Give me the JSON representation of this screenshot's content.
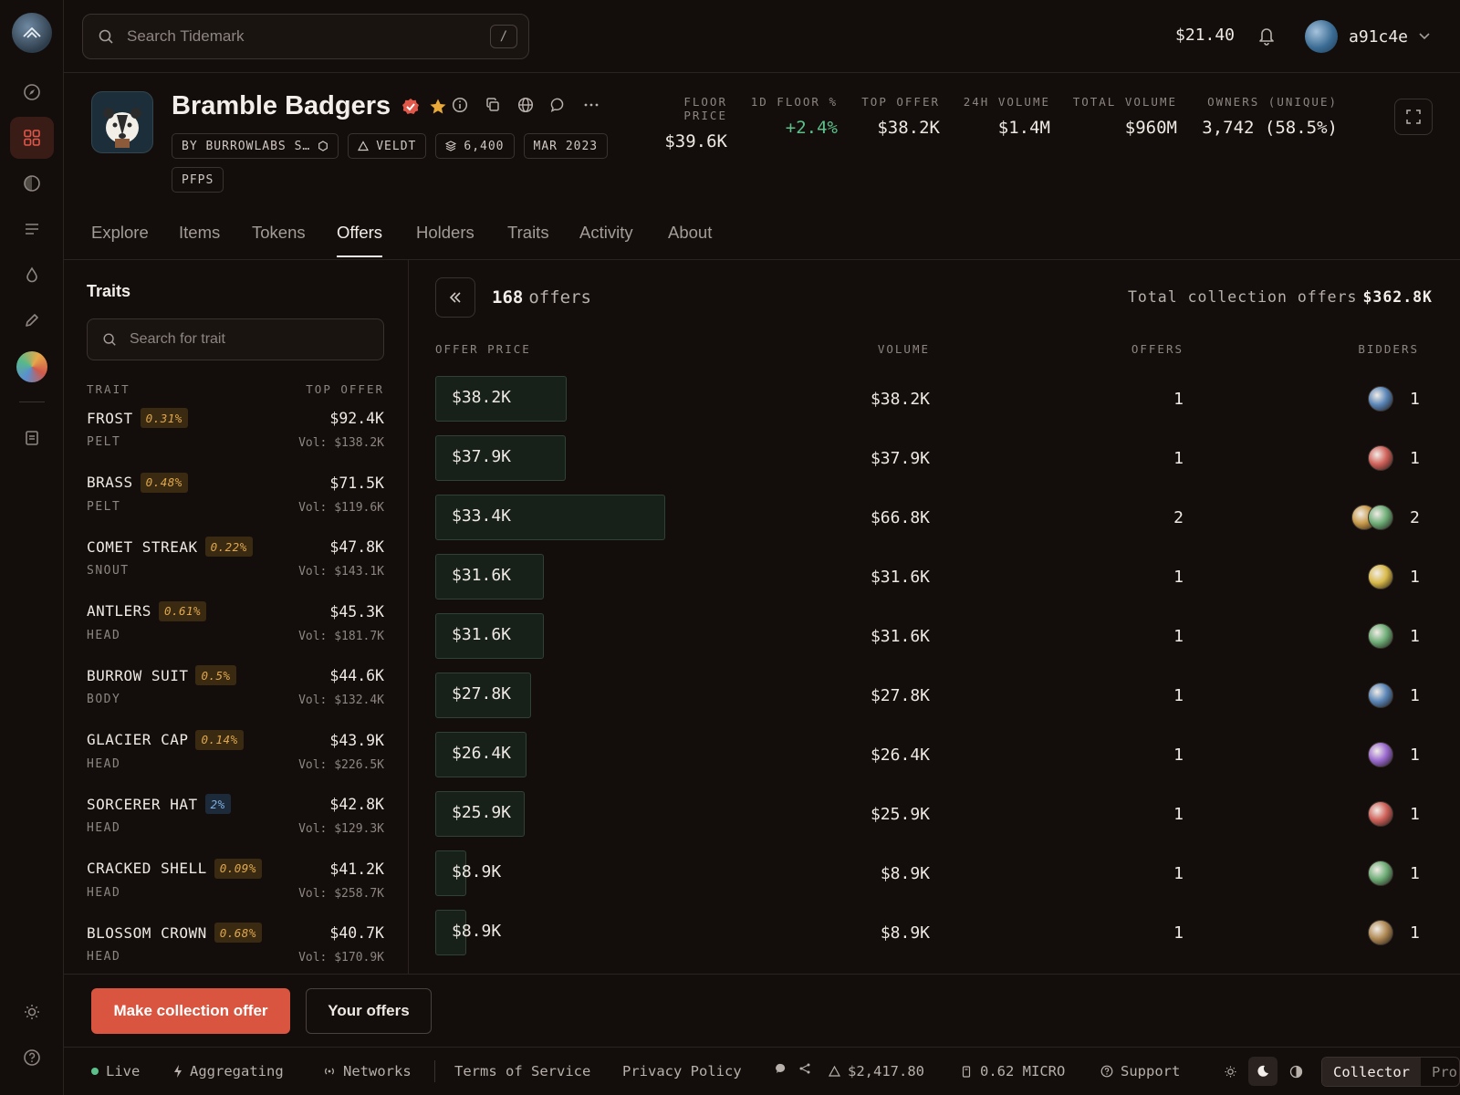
{
  "app": {
    "name": "Tidemark"
  },
  "topbar": {
    "search_placeholder": "Search Tidemark",
    "search_shortcut": "/",
    "balance": "$21.40",
    "username": "a91c4e"
  },
  "rail": {
    "items": [
      "explore-icon",
      "grid-icon",
      "half-circle-icon",
      "list-icon",
      "drop-icon",
      "pencil-icon",
      "avatar",
      "document-icon"
    ],
    "bottom": [
      "sun-icon",
      "help-icon"
    ]
  },
  "collection": {
    "name": "Bramble Badgers",
    "chips": [
      "BY BURROWLABS S…",
      "VELDT",
      "6,400",
      "MAR 2023",
      "PFPS"
    ],
    "stats": [
      {
        "label": "FLOOR PRICE",
        "value": "$39.6K"
      },
      {
        "label": "1D FLOOR %",
        "value": "+2.4%"
      },
      {
        "label": "TOP OFFER",
        "value": "$38.2K"
      },
      {
        "label": "24H VOLUME",
        "value": "$1.4M"
      },
      {
        "label": "TOTAL VOLUME",
        "value": "$960M"
      },
      {
        "label": "OWNERS (UNIQUE)",
        "value": "3,742 (58.5%)"
      }
    ]
  },
  "tabs": [
    "Explore",
    "Items",
    "Tokens",
    "Offers",
    "Holders",
    "Traits",
    "Activity",
    "About"
  ],
  "active_tab": "Offers",
  "traits_panel": {
    "title": "Traits",
    "search_placeholder": "Search for trait",
    "col_trait": "TRAIT",
    "col_top_offer": "TOP OFFER",
    "items": [
      {
        "name": "FROST",
        "pct": "0.31%",
        "category": "PELT",
        "top_offer": "$92.4K",
        "vol": "Vol: $138.2K"
      },
      {
        "name": "BRASS",
        "pct": "0.48%",
        "category": "PELT",
        "top_offer": "$71.5K",
        "vol": "Vol: $119.6K"
      },
      {
        "name": "COMET STREAK",
        "pct": "0.22%",
        "category": "SNOUT",
        "top_offer": "$47.8K",
        "vol": "Vol: $143.1K"
      },
      {
        "name": "ANTLERS",
        "pct": "0.61%",
        "category": "HEAD",
        "top_offer": "$45.3K",
        "vol": "Vol: $181.7K"
      },
      {
        "name": "BURROW SUIT",
        "pct": "0.5%",
        "category": "BODY",
        "top_offer": "$44.6K",
        "vol": "Vol: $132.4K"
      },
      {
        "name": "GLACIER CAP",
        "pct": "0.14%",
        "category": "HEAD",
        "top_offer": "$43.9K",
        "vol": "Vol: $226.5K"
      },
      {
        "name": "SORCERER HAT",
        "pct": "2%",
        "category": "HEAD",
        "top_offer": "$42.8K",
        "vol": "Vol: $129.3K"
      },
      {
        "name": "CRACKED SHELL",
        "pct": "0.09%",
        "category": "HEAD",
        "top_offer": "$41.2K",
        "vol": "Vol: $258.7K"
      },
      {
        "name": "BLOSSOM CROWN",
        "pct": "0.68%",
        "category": "HEAD",
        "top_offer": "$40.7K",
        "vol": "Vol: $170.9K"
      }
    ]
  },
  "offers_panel": {
    "count": "168",
    "count_label": "offers",
    "total_label": "Total collection offers",
    "total_value": "$362.8K",
    "columns": [
      "OFFER PRICE",
      "VOLUME",
      "OFFERS",
      "BIDDERS"
    ],
    "rows": [
      {
        "price": "$38.2K",
        "price_k": 38.2,
        "volume": "$38.2K",
        "volume_k": 38.2,
        "offers": "1",
        "bidders": "1",
        "avatars": [
          "#5a86b8"
        ]
      },
      {
        "price": "$37.9K",
        "price_k": 37.9,
        "volume": "$37.9K",
        "volume_k": 37.9,
        "offers": "1",
        "bidders": "1",
        "avatars": [
          "#d0625a"
        ]
      },
      {
        "price": "$33.4K",
        "price_k": 33.4,
        "volume": "$66.8K",
        "volume_k": 66.8,
        "offers": "2",
        "bidders": "2",
        "avatars": [
          "#6fae78",
          "#c89a4a"
        ]
      },
      {
        "price": "$31.6K",
        "price_k": 31.6,
        "volume": "$31.6K",
        "volume_k": 31.6,
        "offers": "1",
        "bidders": "1",
        "avatars": [
          "#d8b94a"
        ]
      },
      {
        "price": "$31.6K",
        "price_k": 31.6,
        "volume": "$31.6K",
        "volume_k": 31.6,
        "offers": "1",
        "bidders": "1",
        "avatars": [
          "#6fae78"
        ]
      },
      {
        "price": "$27.8K",
        "price_k": 27.8,
        "volume": "$27.8K",
        "volume_k": 27.8,
        "offers": "1",
        "bidders": "1",
        "avatars": [
          "#5a86b8"
        ]
      },
      {
        "price": "$26.4K",
        "price_k": 26.4,
        "volume": "$26.4K",
        "volume_k": 26.4,
        "offers": "1",
        "bidders": "1",
        "avatars": [
          "#9a6ad0"
        ]
      },
      {
        "price": "$25.9K",
        "price_k": 25.9,
        "volume": "$25.9K",
        "volume_k": 25.9,
        "offers": "1",
        "bidders": "1",
        "avatars": [
          "#d0625a"
        ]
      },
      {
        "price": "$8.9K",
        "price_k": 8.9,
        "volume": "$8.9K",
        "volume_k": 8.9,
        "offers": "1",
        "bidders": "1",
        "avatars": [
          "#6fae78"
        ]
      },
      {
        "price": "$8.9K",
        "price_k": 8.9,
        "volume": "$8.9K",
        "volume_k": 8.9,
        "offers": "1",
        "bidders": "1",
        "avatars": [
          "#b08a55"
        ]
      }
    ]
  },
  "actions": {
    "primary": "Make collection offer",
    "secondary": "Your offers"
  },
  "statusbar": {
    "live": "Live",
    "aggregating": "Aggregating",
    "networks": "Networks",
    "terms": "Terms of Service",
    "privacy": "Privacy Policy",
    "price": "$2,417.80",
    "micro": "0.62 MICRO",
    "support": "Support",
    "modes": [
      "Collector",
      "Pro"
    ]
  },
  "colors": {
    "accent": "#d9553f",
    "positive": "#5cc08a",
    "bar": "#17211a"
  }
}
